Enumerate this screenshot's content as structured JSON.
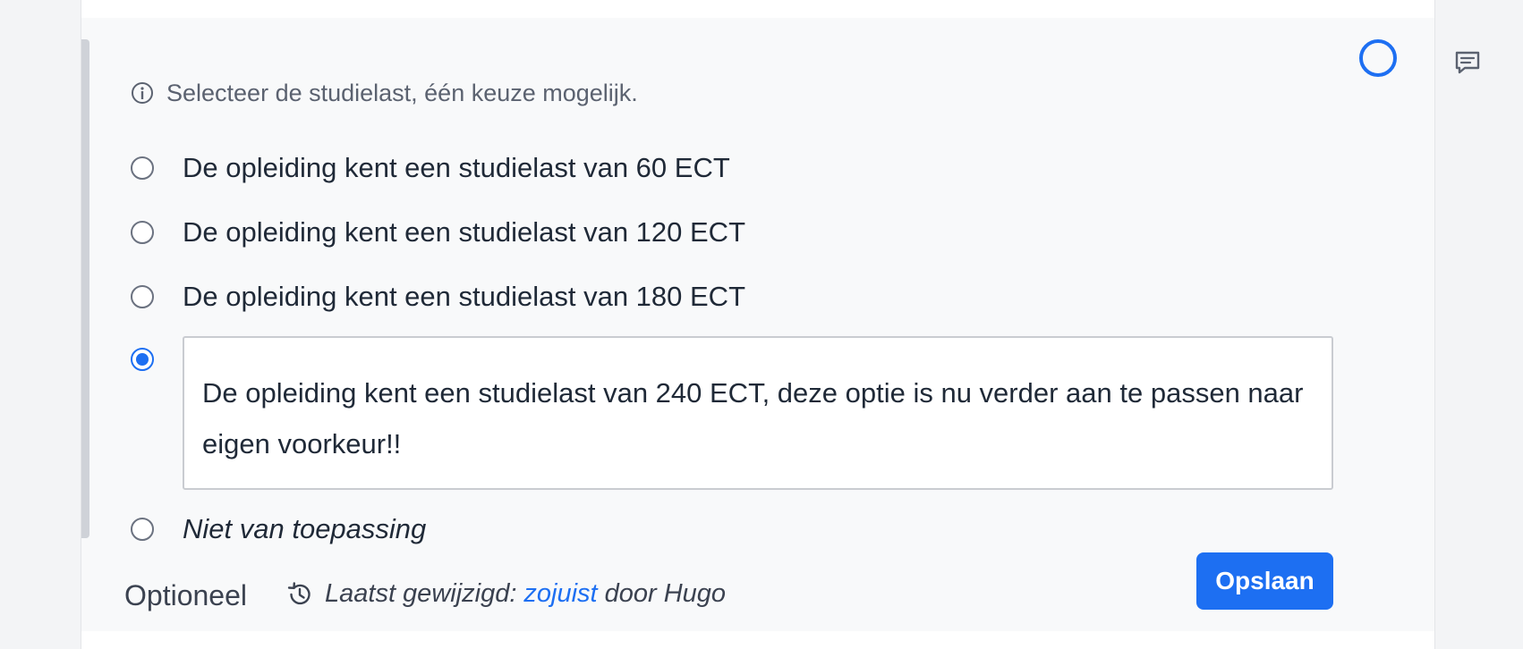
{
  "question": {
    "hint": "Selecteer de studielast, één keuze mogelijk.",
    "options": [
      {
        "label": "De opleiding kent een studielast van 60 ECT",
        "checked": false
      },
      {
        "label": "De opleiding kent een studielast van 120 ECT",
        "checked": false
      },
      {
        "label": "De opleiding kent een studielast van 180 ECT",
        "checked": false
      },
      {
        "label": "De opleiding kent een studielast van 240 ECT, deze optie is nu verder aan te passen naar eigen voorkeur!!",
        "checked": true
      },
      {
        "label": "Niet van toepassing",
        "checked": false
      }
    ]
  },
  "footer": {
    "optional_label": "Optioneel",
    "history_prefix": "Laatst gewijzigd:",
    "history_link": "zojuist",
    "history_suffix": "door Hugo",
    "save_label": "Opslaan"
  },
  "colors": {
    "accent": "#1d6ff2",
    "card_background": "#f8f9fa",
    "text": "#1f2937"
  },
  "icons": {
    "info": "info-circle-icon",
    "status": "status-circle-icon",
    "comment": "comment-icon",
    "history": "history-icon"
  }
}
